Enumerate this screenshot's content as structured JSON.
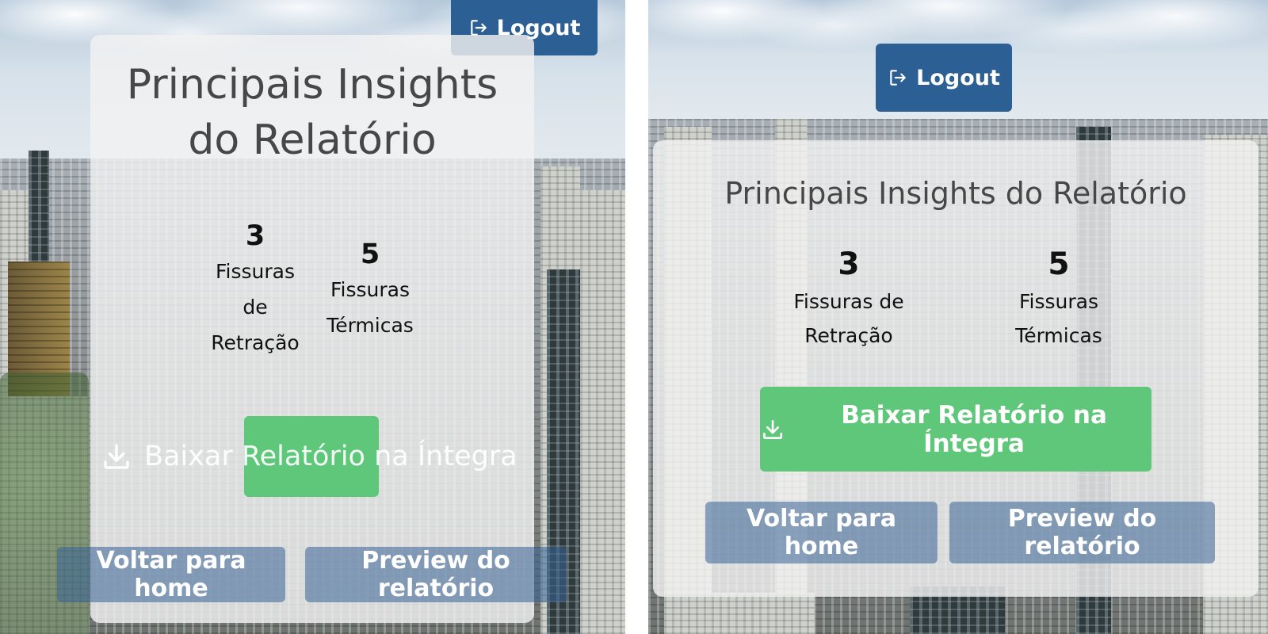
{
  "header": {
    "logout_label": "Logout"
  },
  "insights": {
    "title": "Principais Insights do Relatório",
    "title_line1": "Principais Insights",
    "title_line2": "do Relatório",
    "stats": [
      {
        "value": "3",
        "label": "Fissuras de Retração",
        "label_lines": [
          "Fissuras",
          "de",
          "Retração"
        ]
      },
      {
        "value": "5",
        "label": "Fissuras Térmicas",
        "label_lines": [
          "Fissuras",
          "Térmicas"
        ]
      }
    ],
    "right_stats_label_lines": [
      [
        "Fissuras de",
        "Retração"
      ],
      [
        "Fissuras",
        "Térmicas"
      ]
    ]
  },
  "actions": {
    "download_label": "Baixar Relatório na Íntegra",
    "home_label": "Voltar para home",
    "preview_label": "Preview do relatório"
  },
  "colors": {
    "primary": "#2c5f93",
    "success": "#5fc77a",
    "card_background": "#f2f2f2",
    "title_text": "#474747"
  },
  "icons": {
    "logout": "logout-icon",
    "download": "download-icon"
  }
}
